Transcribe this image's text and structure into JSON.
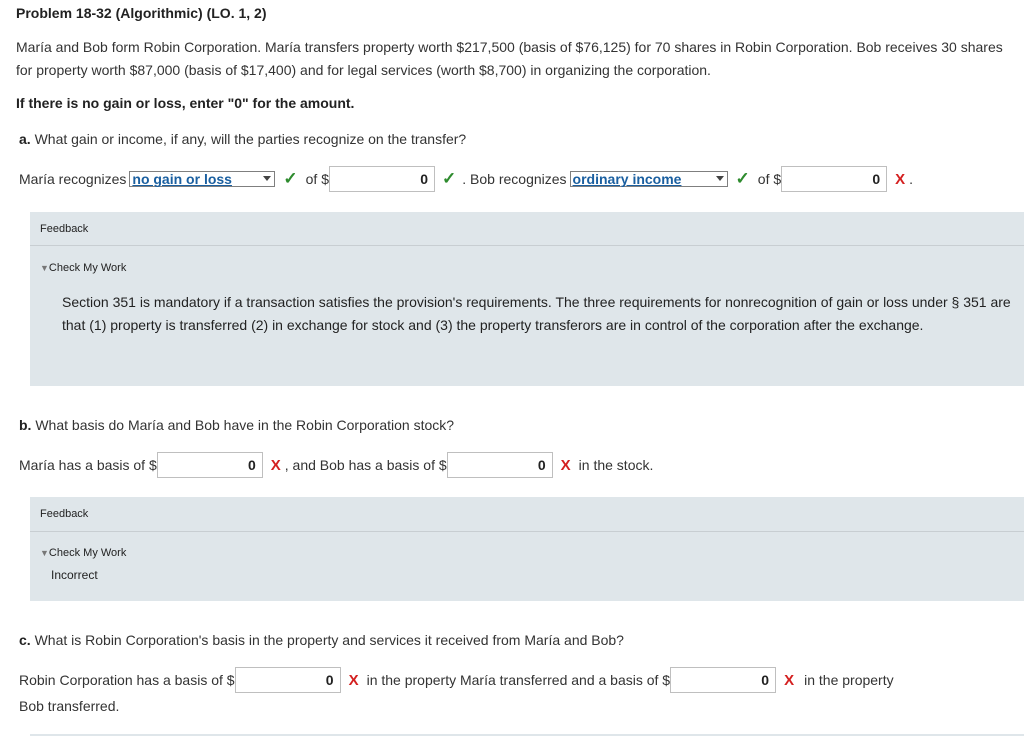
{
  "title": "Problem 18-32 (Algorithmic) (LO. 1, 2)",
  "intro": "María and Bob form Robin Corporation. María transfers property worth $217,500 (basis of $76,125) for 70 shares in Robin Corporation. Bob receives 30 shares for property worth $87,000 (basis of $17,400) and for legal services (worth $8,700) in organizing the corporation.",
  "instruction": "If there is no gain or loss, enter \"0\" for the amount.",
  "part_a": {
    "letter": "a.",
    "question": "What gain or income, if any, will the parties recognize on the transfer?",
    "maria_prefix": "María recognizes",
    "maria_select": "no gain or loss",
    "of_label": "of $",
    "maria_amount": "0",
    "bob_prefix": ". Bob recognizes",
    "bob_select": "ordinary income",
    "bob_amount": "0",
    "check": "✓",
    "x": "X",
    "trailing": "."
  },
  "feedback_a": {
    "label": "Feedback",
    "check_my_work": "Check My Work",
    "text": "Section 351 is mandatory if a transaction satisfies the provision's requirements. The three requirements for nonrecognition of gain or loss under § 351 are that (1) property is transferred (2) in exchange for stock and (3) the property transferors are in control of the corporation after the exchange."
  },
  "part_b": {
    "letter": "b.",
    "question": "What basis do María and Bob have in the Robin Corporation stock?",
    "maria_prefix": "María has a basis of $",
    "maria_amount": "0",
    "middle": ", and Bob has a basis of $",
    "bob_amount": "0",
    "suffix": "in the stock.",
    "x": "X"
  },
  "feedback_b": {
    "label": "Feedback",
    "check_my_work": "Check My Work",
    "text": "Incorrect"
  },
  "part_c": {
    "letter": "c.",
    "question": "What is Robin Corporation's basis in the property and services it received from María and Bob?",
    "prefix": "Robin Corporation has a basis of $",
    "amount1": "0",
    "middle": "in the property María transferred and a basis of $",
    "amount2": "0",
    "suffix": "in the property",
    "line2": "Bob transferred.",
    "x": "X"
  },
  "colors": {
    "check": "#2e8b2e",
    "x": "#d42020",
    "link": "#1a5fa0",
    "feedback_bg": "#dfe6ea"
  }
}
